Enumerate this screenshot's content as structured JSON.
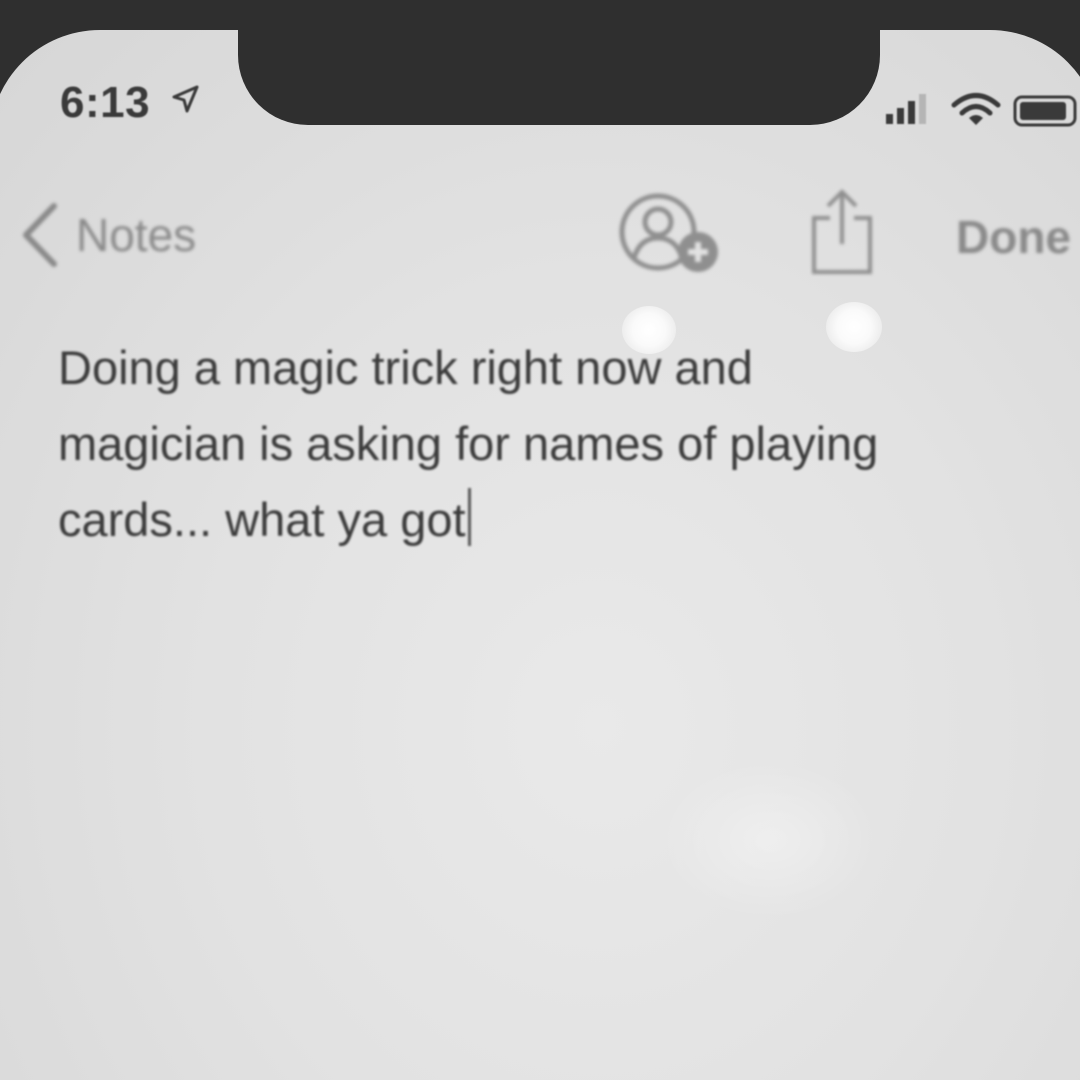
{
  "status_bar": {
    "time": "6:13",
    "location_icon": "location-arrow-icon",
    "signal_icon": "cellular-signal-icon",
    "wifi_icon": "wifi-icon",
    "battery_icon": "battery-icon"
  },
  "nav": {
    "back_label": "Notes",
    "back_icon": "chevron-left-icon",
    "add_person_icon": "add-person-icon",
    "share_icon": "share-icon",
    "done_label": "Done"
  },
  "note": {
    "lines": [
      "Doing a magic trick right now and",
      "magician is asking for names of playing",
      "cards... what ya got"
    ]
  },
  "colors": {
    "frame": "#2f2f2f",
    "screen_background": "#e2e2e2",
    "text": "#3b3b3b",
    "nav_tint": "#8a8a8a"
  }
}
